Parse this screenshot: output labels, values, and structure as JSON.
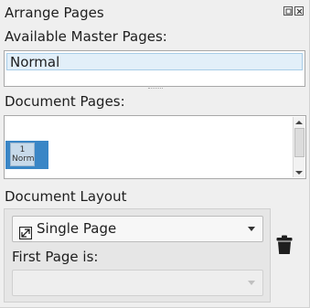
{
  "panel": {
    "title": "Arrange Pages",
    "float_button": "float-icon",
    "close_button": "close-icon"
  },
  "master_pages": {
    "label": "Available Master Pages:",
    "items": [
      "Normal"
    ]
  },
  "document_pages": {
    "label": "Document Pages:",
    "pages": [
      {
        "number": "1",
        "master": "Normal"
      }
    ]
  },
  "layout": {
    "label": "Document Layout",
    "mode_icon": "single-page-icon",
    "mode_value": "Single Page",
    "first_page_label": "First Page is:",
    "first_page_value": ""
  },
  "trash": {
    "icon": "trash-icon"
  },
  "colors": {
    "accent": "#3a86c6",
    "selection": "#e2eff9",
    "background": "#efefef"
  }
}
